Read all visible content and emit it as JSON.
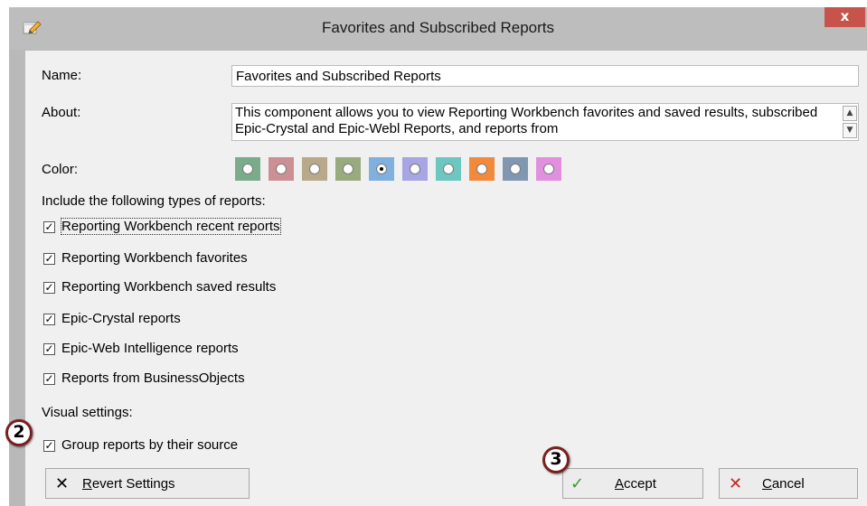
{
  "window": {
    "title": "Favorites and Subscribed Reports",
    "close_glyph": "x"
  },
  "form": {
    "name_label": "Name:",
    "name_value": "Favorites and Subscribed Reports",
    "about_label": "About:",
    "about_text": "This component allows you to view Reporting Workbench favorites and saved results, subscribed Epic-Crystal and Epic-Webl Reports, and reports from",
    "color_label": "Color:",
    "colors": [
      "#7aab8a",
      "#cb8f94",
      "#b9a98b",
      "#9aaa7f",
      "#7fb0de",
      "#a7a5e3",
      "#6dc6c0",
      "#f28a3d",
      "#7f97b1",
      "#e090df"
    ],
    "selected_color_index": 4,
    "include_label": "Include the following types of reports:",
    "report_types": [
      {
        "label": "Reporting Workbench recent reports",
        "checked": true
      },
      {
        "label": "Reporting Workbench favorites",
        "checked": true
      },
      {
        "label": "Reporting Workbench saved results",
        "checked": true
      },
      {
        "label": "Epic-Crystal reports",
        "checked": true
      },
      {
        "label": "Epic-Web Intelligence reports",
        "checked": true
      },
      {
        "label": "Reports from BusinessObjects",
        "checked": true
      }
    ],
    "visual_label": "Visual settings:",
    "group_label": "Group reports by their source",
    "group_checked": true,
    "check_glyph": "✓"
  },
  "buttons": {
    "revert_first": "R",
    "revert_rest": "evert Settings",
    "accept_first": "A",
    "accept_rest": "ccept",
    "cancel_first": "C",
    "cancel_rest": "ancel"
  },
  "callouts": {
    "step2": "2",
    "step3": "3"
  }
}
